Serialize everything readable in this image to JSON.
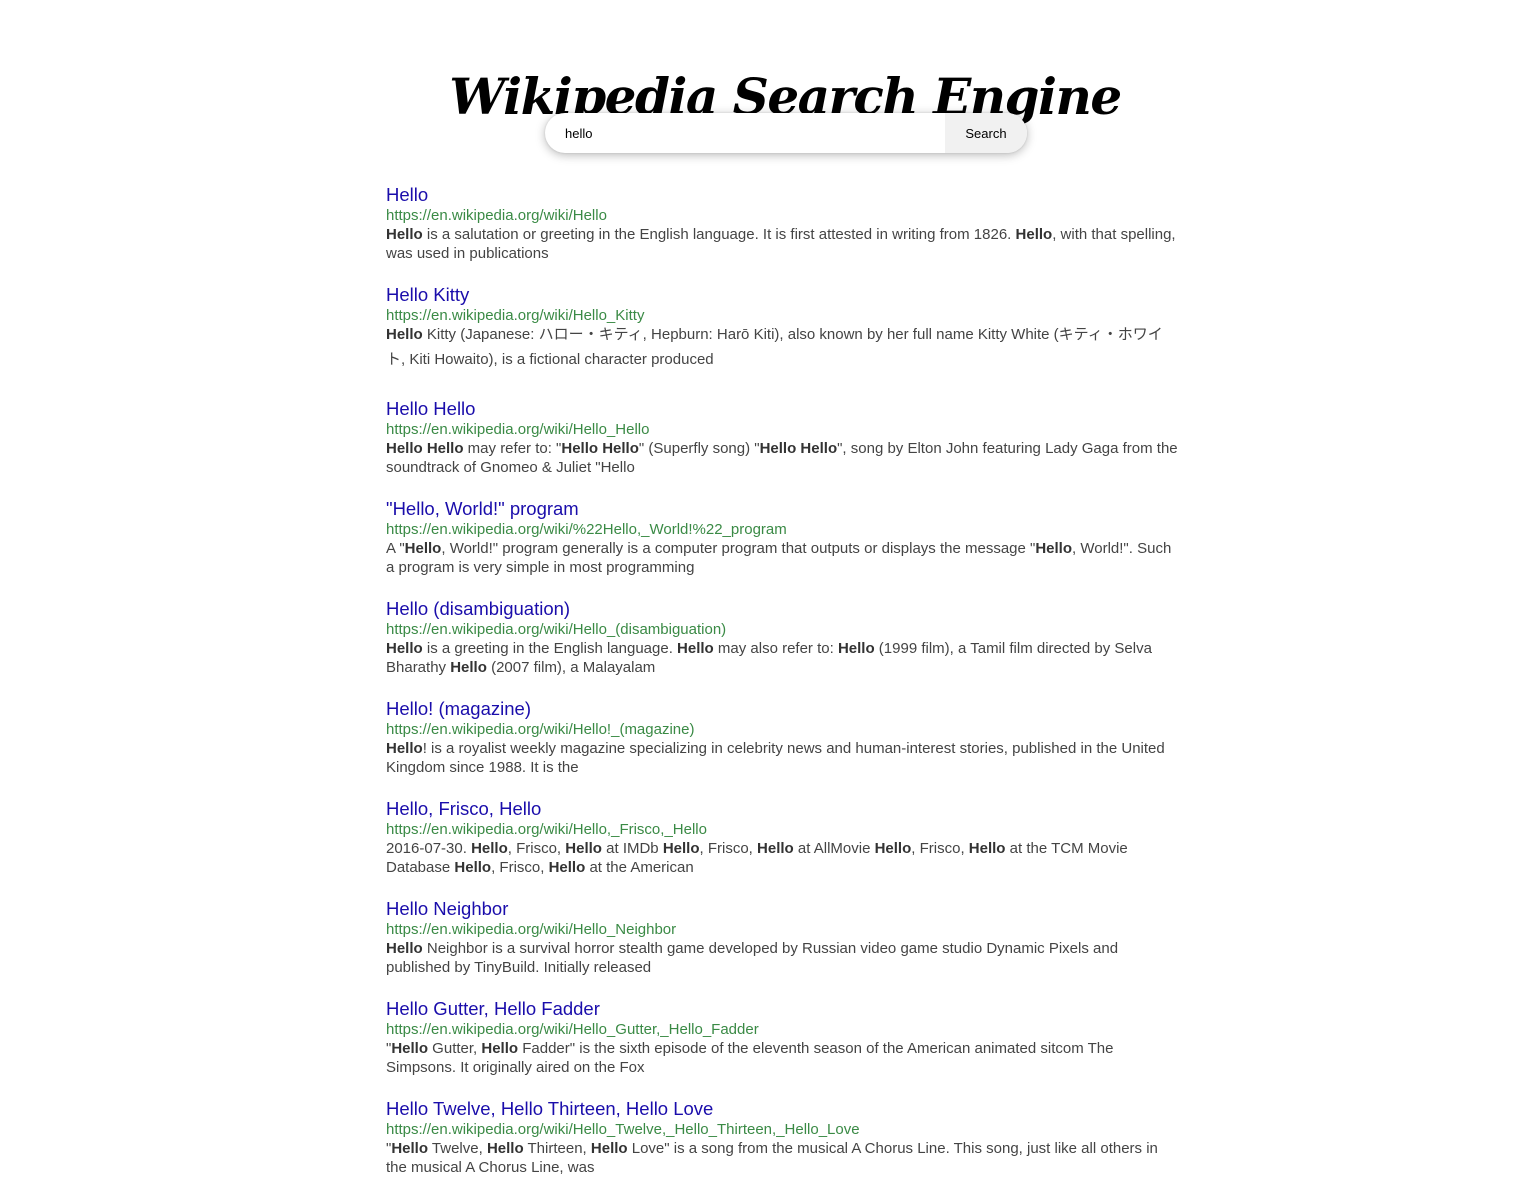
{
  "header": {
    "title": "Wikipedia Search Engine"
  },
  "search": {
    "query": "hello",
    "button_label": "Search"
  },
  "results": [
    {
      "title": "Hello",
      "url": "https://en.wikipedia.org/wiki/Hello",
      "snippet": [
        {
          "text": "Hello",
          "bold": true
        },
        {
          "text": " is a salutation or greeting in the English language. It is first attested in writing from 1826. "
        },
        {
          "text": "Hello",
          "bold": true
        },
        {
          "text": ", with that spelling, was used in publications"
        }
      ]
    },
    {
      "title": "Hello Kitty",
      "url": "https://en.wikipedia.org/wiki/Hello_Kitty",
      "tall": true,
      "snippet": [
        {
          "text": "Hello",
          "bold": true
        },
        {
          "text": " Kitty (Japanese: ハロー・キティ, Hepburn: Harō Kiti), also known by her full name Kitty White (キティ・ホワイト, Kiti Howaito), is a fictional character produced"
        }
      ]
    },
    {
      "title": "Hello Hello",
      "url": "https://en.wikipedia.org/wiki/Hello_Hello",
      "snippet": [
        {
          "text": "Hello Hello",
          "bold": true
        },
        {
          "text": " may refer to: \""
        },
        {
          "text": "Hello Hello",
          "bold": true
        },
        {
          "text": "\" (Superfly song) \""
        },
        {
          "text": "Hello Hello",
          "bold": true
        },
        {
          "text": "\", song by Elton John featuring Lady Gaga from the soundtrack of Gnomeo & Juliet \"Hello"
        }
      ]
    },
    {
      "title": "\"Hello, World!\" program",
      "url": "https://en.wikipedia.org/wiki/%22Hello,_World!%22_program",
      "snippet": [
        {
          "text": "A \""
        },
        {
          "text": "Hello",
          "bold": true
        },
        {
          "text": ", World!\" program generally is a computer program that outputs or displays the message \""
        },
        {
          "text": "Hello",
          "bold": true
        },
        {
          "text": ", World!\". Such a program is very simple in most programming"
        }
      ]
    },
    {
      "title": "Hello (disambiguation)",
      "url": "https://en.wikipedia.org/wiki/Hello_(disambiguation)",
      "snippet": [
        {
          "text": "Hello",
          "bold": true
        },
        {
          "text": " is a greeting in the English language. "
        },
        {
          "text": "Hello",
          "bold": true
        },
        {
          "text": " may also refer to: "
        },
        {
          "text": "Hello",
          "bold": true
        },
        {
          "text": " (1999 film), a Tamil film directed by Selva Bharathy "
        },
        {
          "text": "Hello",
          "bold": true
        },
        {
          "text": " (2007 film), a Malayalam"
        }
      ]
    },
    {
      "title": "Hello! (magazine)",
      "url": "https://en.wikipedia.org/wiki/Hello!_(magazine)",
      "snippet": [
        {
          "text": "Hello",
          "bold": true
        },
        {
          "text": "! is a royalist weekly magazine specializing in celebrity news and human-interest stories, published in the United Kingdom since 1988. It is the"
        }
      ]
    },
    {
      "title": "Hello, Frisco, Hello",
      "url": "https://en.wikipedia.org/wiki/Hello,_Frisco,_Hello",
      "snippet": [
        {
          "text": "2016-07-30. "
        },
        {
          "text": "Hello",
          "bold": true
        },
        {
          "text": ", Frisco, "
        },
        {
          "text": "Hello",
          "bold": true
        },
        {
          "text": " at IMDb  "
        },
        {
          "text": "Hello",
          "bold": true
        },
        {
          "text": ", Frisco, "
        },
        {
          "text": "Hello",
          "bold": true
        },
        {
          "text": " at AllMovie "
        },
        {
          "text": "Hello",
          "bold": true
        },
        {
          "text": ", Frisco, "
        },
        {
          "text": "Hello",
          "bold": true
        },
        {
          "text": " at the TCM Movie Database "
        },
        {
          "text": "Hello",
          "bold": true
        },
        {
          "text": ", Frisco, "
        },
        {
          "text": "Hello",
          "bold": true
        },
        {
          "text": " at the American"
        }
      ]
    },
    {
      "title": "Hello Neighbor",
      "url": "https://en.wikipedia.org/wiki/Hello_Neighbor",
      "snippet": [
        {
          "text": "Hello",
          "bold": true
        },
        {
          "text": " Neighbor is a survival horror stealth game developed by Russian video game studio Dynamic Pixels and published by TinyBuild. Initially released"
        }
      ]
    },
    {
      "title": "Hello Gutter, Hello Fadder",
      "url": "https://en.wikipedia.org/wiki/Hello_Gutter,_Hello_Fadder",
      "snippet": [
        {
          "text": "\""
        },
        {
          "text": "Hello",
          "bold": true
        },
        {
          "text": " Gutter, "
        },
        {
          "text": "Hello",
          "bold": true
        },
        {
          "text": " Fadder\" is the sixth episode of the eleventh season of the American animated sitcom The Simpsons. It originally aired on the Fox"
        }
      ]
    },
    {
      "title": "Hello Twelve, Hello Thirteen, Hello Love",
      "url": "https://en.wikipedia.org/wiki/Hello_Twelve,_Hello_Thirteen,_Hello_Love",
      "snippet": [
        {
          "text": "\""
        },
        {
          "text": "Hello",
          "bold": true
        },
        {
          "text": " Twelve, "
        },
        {
          "text": "Hello",
          "bold": true
        },
        {
          "text": " Thirteen, "
        },
        {
          "text": "Hello",
          "bold": true
        },
        {
          "text": " Love\" is a song from the musical A Chorus Line. This song, just like all others in the musical A Chorus Line, was"
        }
      ]
    }
  ]
}
